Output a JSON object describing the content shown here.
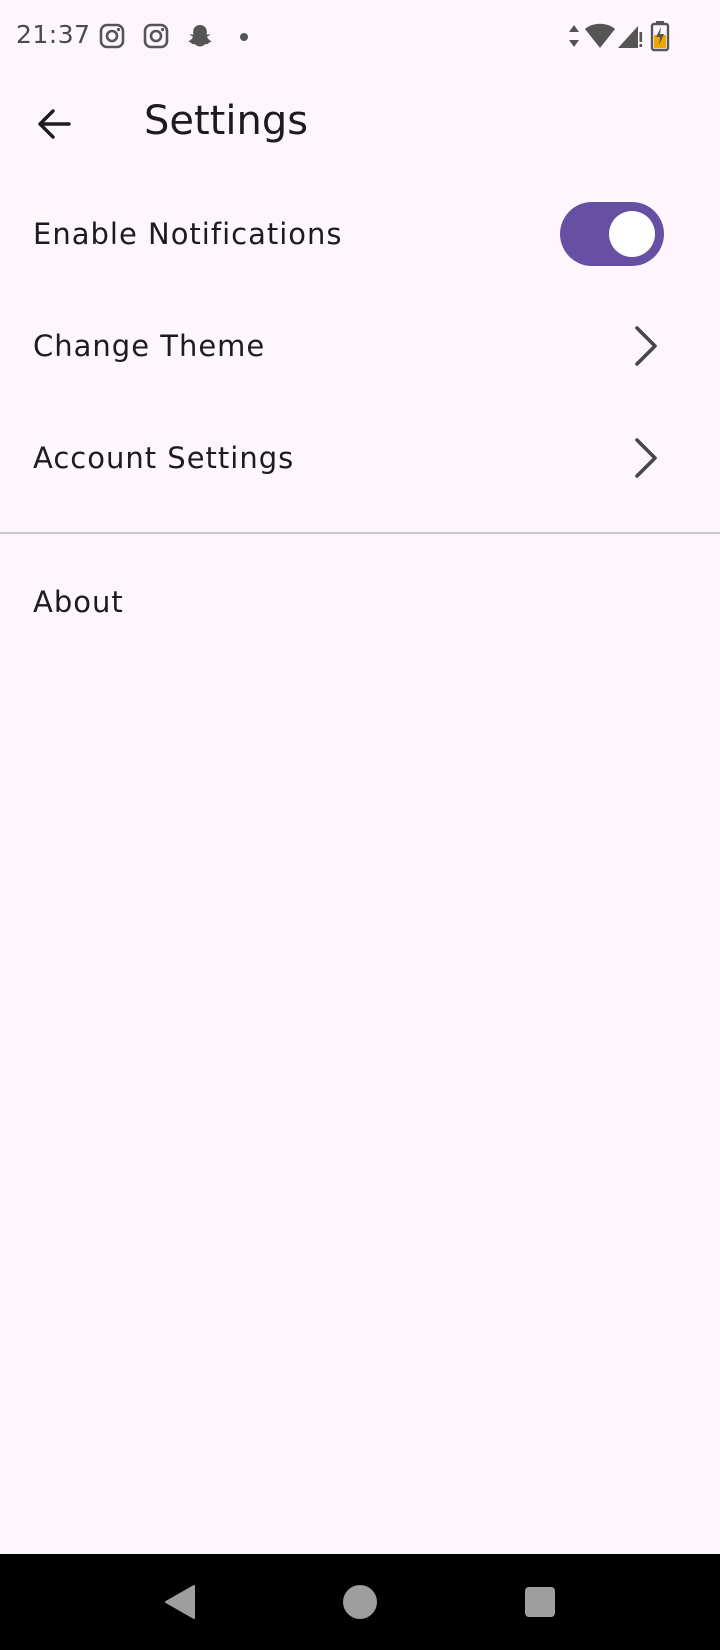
{
  "status_bar": {
    "time": "21:37",
    "left_icons": [
      "instagram-icon",
      "instagram-icon",
      "snapchat-icon",
      "notification-dot"
    ],
    "right_icons": [
      "data-transfer-icon",
      "wifi-icon",
      "signal-icon",
      "battery-charging-icon"
    ]
  },
  "app_bar": {
    "title": "Settings",
    "back_icon": "arrow-left-icon"
  },
  "settings": {
    "notifications": {
      "label": "Enable Notifications",
      "enabled": true
    },
    "theme": {
      "label": "Change Theme"
    },
    "account": {
      "label": "Account Settings"
    },
    "about": {
      "label": "About"
    }
  },
  "colors": {
    "background": "#fdf7fd",
    "accent": "#6750a4",
    "text": "#1d1b20",
    "divider": "#c9c5ca"
  },
  "nav_bar": {
    "buttons": [
      "back-triangle-icon",
      "home-circle-icon",
      "recents-square-icon"
    ]
  }
}
